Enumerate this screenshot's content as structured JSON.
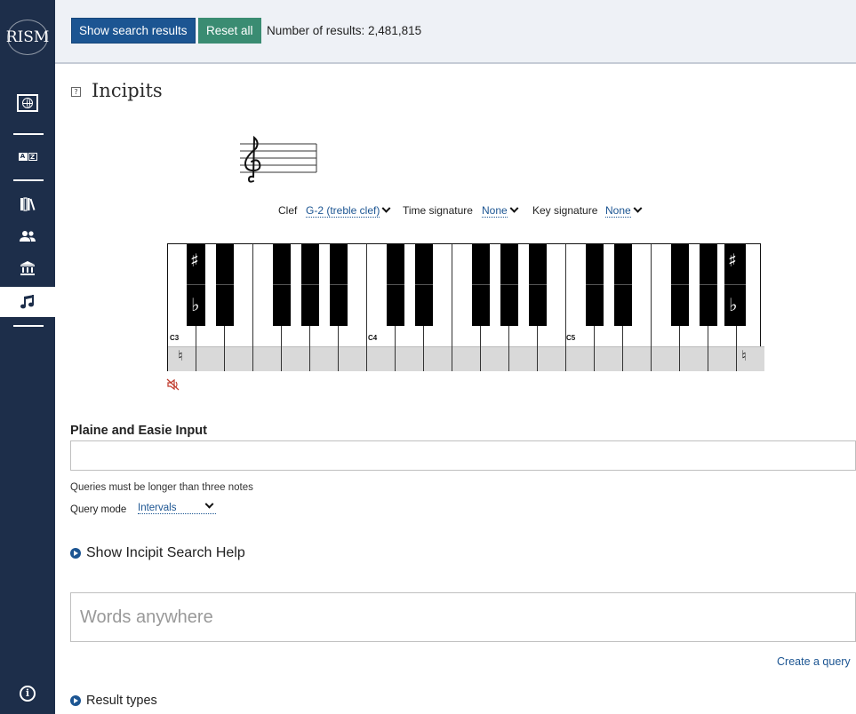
{
  "sidebar": {
    "logo_text": "RISM",
    "items": [
      {
        "name": "globe-icon"
      },
      {
        "name": "az-icon",
        "a": "A",
        "z": "Z"
      },
      {
        "name": "books-icon"
      },
      {
        "name": "people-icon"
      },
      {
        "name": "institution-icon"
      },
      {
        "name": "music-note-icon",
        "active": true
      }
    ],
    "info_glyph": "i"
  },
  "toolbar": {
    "show_results_label": "Show search results",
    "reset_label": "Reset all",
    "result_count_text": "Number of results: 2,481,815"
  },
  "incipits": {
    "title": "Incipits",
    "help_glyph": "?",
    "clef_label": "Clef",
    "clef_value": "G-2 (treble clef)",
    "time_sig_label": "Time signature",
    "time_sig_value": "None",
    "key_sig_label": "Key signature",
    "key_sig_value": "None",
    "octave_labels": [
      "C3",
      "C4",
      "C5"
    ],
    "sharp_glyph": "♯",
    "flat_glyph": "♭",
    "natural_glyph": "♮"
  },
  "pae": {
    "label": "Plaine and Easie Input",
    "value": "",
    "hint": "Queries must be longer than three notes",
    "query_mode_label": "Query mode",
    "query_mode_value": "Intervals"
  },
  "help_toggle_label": "Show Incipit Search Help",
  "words_input_placeholder": "Words anywhere",
  "create_query_label": "Create a query",
  "result_types_label": "Result types",
  "colors": {
    "sidebar": "#1d2e4a",
    "primary_button": "#1c5592",
    "reset_button": "#3a8c72",
    "mute_icon": "#c0392b"
  }
}
